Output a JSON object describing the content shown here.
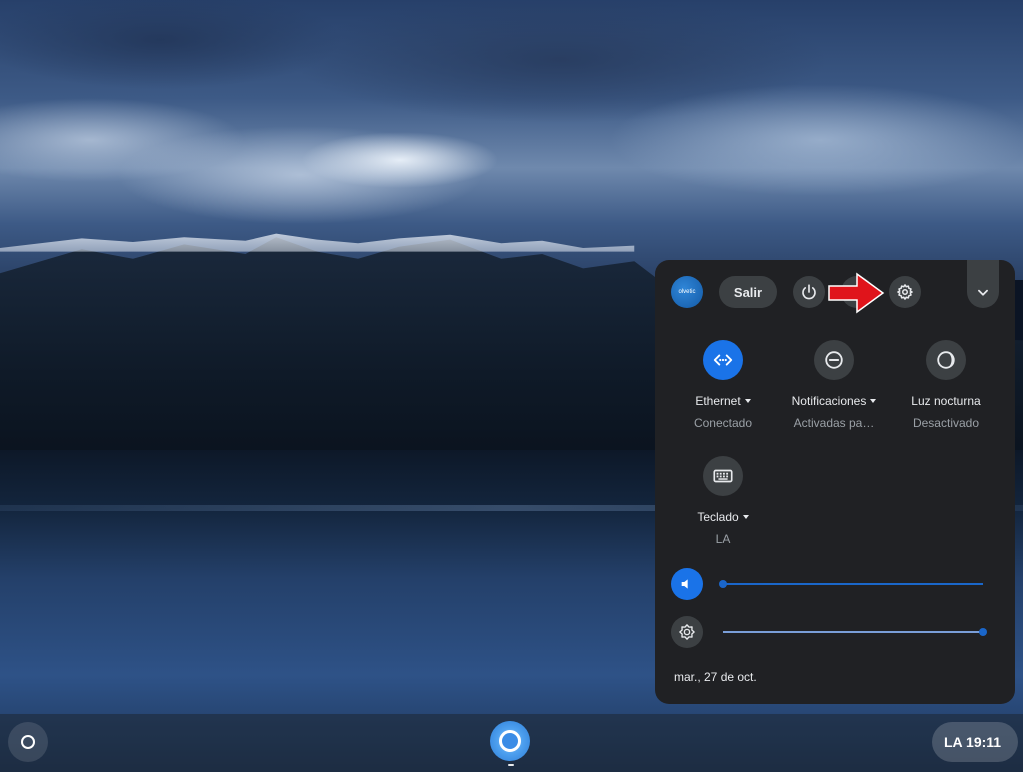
{
  "shelf": {
    "status_text": "LA 19:11"
  },
  "quick_settings": {
    "avatar_text": "olvetic",
    "signout_label": "Salir",
    "tiles": {
      "ethernet": {
        "label": "Ethernet",
        "status": "Conectado"
      },
      "notifications": {
        "label": "Notificaciones",
        "status": "Activadas pa…"
      },
      "night_light": {
        "label": "Luz nocturna",
        "status": "Desactivado"
      },
      "keyboard": {
        "label": "Teclado",
        "status": "LA"
      }
    },
    "volume_level": 0.0,
    "brightness_level": 1.0,
    "date": "mar., 27 de oct."
  },
  "colors": {
    "accent": "#1a73e8",
    "panel_bg": "#202124",
    "button_bg": "#3c4043",
    "annotation_arrow": "#e0141b"
  },
  "icons": [
    "launcher-icon",
    "chrome-icon",
    "power-icon",
    "lock-icon",
    "settings-gear-icon",
    "chevron-down-icon",
    "ethernet-icon",
    "do-not-disturb-icon",
    "night-light-icon",
    "keyboard-icon",
    "volume-icon",
    "brightness-icon"
  ]
}
